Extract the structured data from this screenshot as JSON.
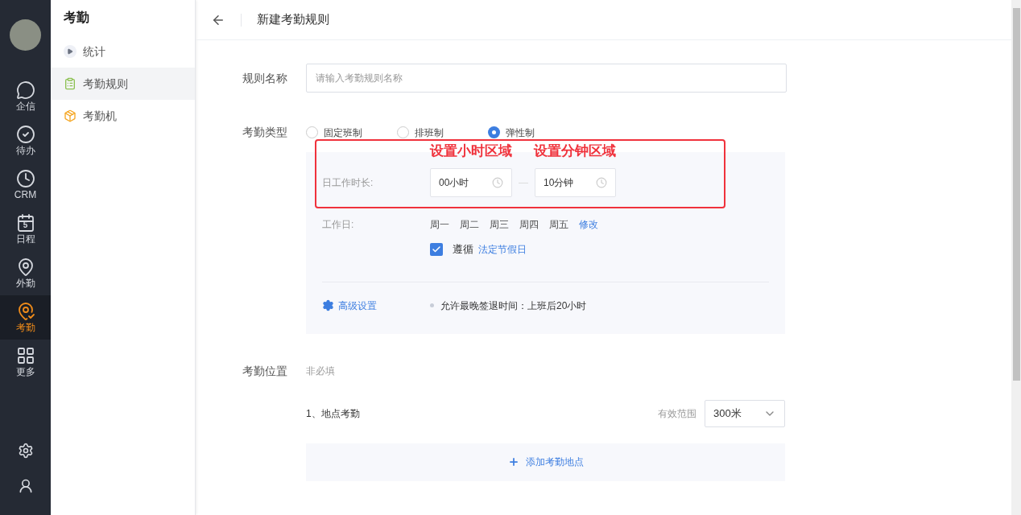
{
  "rail": {
    "items": [
      {
        "label": "企信",
        "kind": "chat",
        "selected": false
      },
      {
        "label": "待办",
        "kind": "check",
        "selected": false
      },
      {
        "label": "CRM",
        "kind": "clock",
        "selected": false
      },
      {
        "label": "日程",
        "kind": "calendar",
        "selected": false,
        "badge": "5"
      },
      {
        "label": "外勤",
        "kind": "pin",
        "selected": false
      },
      {
        "label": "考勤",
        "kind": "pincheck",
        "selected": true
      },
      {
        "label": "更多",
        "kind": "grid",
        "selected": false
      }
    ]
  },
  "submenu": {
    "title": "考勤",
    "items": [
      {
        "label": "统计",
        "kind": "play",
        "selected": false
      },
      {
        "label": "考勤规则",
        "kind": "clipboard",
        "selected": true
      },
      {
        "label": "考勤机",
        "kind": "box",
        "selected": false
      }
    ]
  },
  "header": {
    "title": "新建考勤规则"
  },
  "form": {
    "name_label": "规则名称",
    "name_placeholder": "请输入考勤规则名称",
    "type_label": "考勤类型",
    "types": [
      {
        "label": "固定班制",
        "selected": false
      },
      {
        "label": "排班制",
        "selected": false
      },
      {
        "label": "弹性制",
        "selected": true
      }
    ],
    "hours_label": "日工作时长:",
    "hours_value": "00小时",
    "minutes_value": "10分钟",
    "workdays_label": "工作日:",
    "workdays": [
      "周一",
      "周二",
      "周三",
      "周四",
      "周五"
    ],
    "workdays_edit": "修改",
    "holiday": {
      "checked": true,
      "label": "遵循",
      "link": "法定节假日"
    },
    "advanced_link": "高级设置",
    "advanced_note": "允许最晚签退时间：上班后20小时",
    "location_label": "考勤位置",
    "location_hint": "非必填",
    "location_item": "1、地点考勤",
    "range_label": "有效范围",
    "range_value": "300米",
    "add_location": "添加考勤地点"
  },
  "annotations": [
    {
      "text": "设置小时区域"
    },
    {
      "text": "设置分钟区域"
    }
  ]
}
